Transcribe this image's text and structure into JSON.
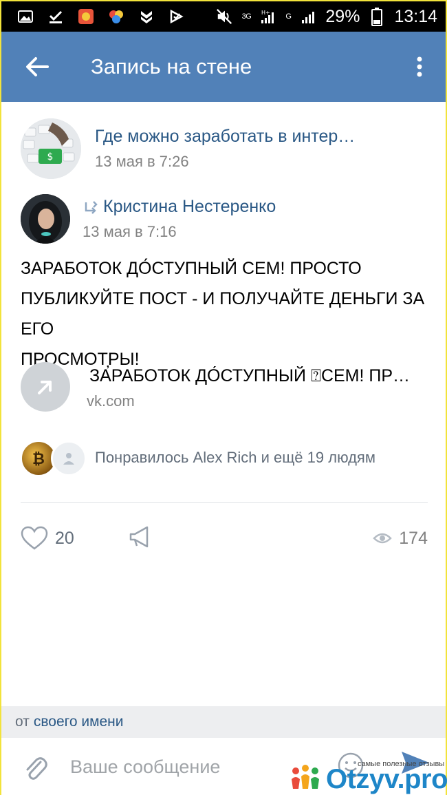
{
  "status_bar": {
    "battery": "29%",
    "time": "13:14",
    "network_1": "3G",
    "network_2": "H+",
    "network_3": "G"
  },
  "header": {
    "title": "Запись на стене"
  },
  "post": {
    "group_name": "Где можно заработать в интер…",
    "group_date": "13 мая в 7:26",
    "author_name": "Кристина Нестеренко",
    "author_date": "13 мая в 7:16",
    "text_line_1": "ЗАРАБОТОК ДО́СТУПНЫЙ  СЕМ! ПРОСТО",
    "text_line_2": "ПУБЛИКУЙТЕ ПОСТ - И ПОЛУЧАЙТЕ ДЕНЬГИ ЗА ЕГО",
    "text_line_3": "ПРОСМОТ̦РЫ!",
    "link_title": "ЗАРАБОТОК ДО́СТУПНЫЙ ⍰СЕМ! ПР…",
    "link_domain": "vk.com",
    "likers_text": "Понравилось Alex Rich и ещё 19 людям",
    "like_count": "20",
    "views_count": "174"
  },
  "from_bar": {
    "prefix": "от",
    "link": "своего имени"
  },
  "composer": {
    "placeholder": "Ваше сообщение"
  },
  "watermark": {
    "tagline": "самые полезные отзывы",
    "logo": "Otzyv.pro"
  },
  "colors": {
    "header": "#5181b8",
    "link": "#2a5885",
    "muted": "#828282"
  }
}
